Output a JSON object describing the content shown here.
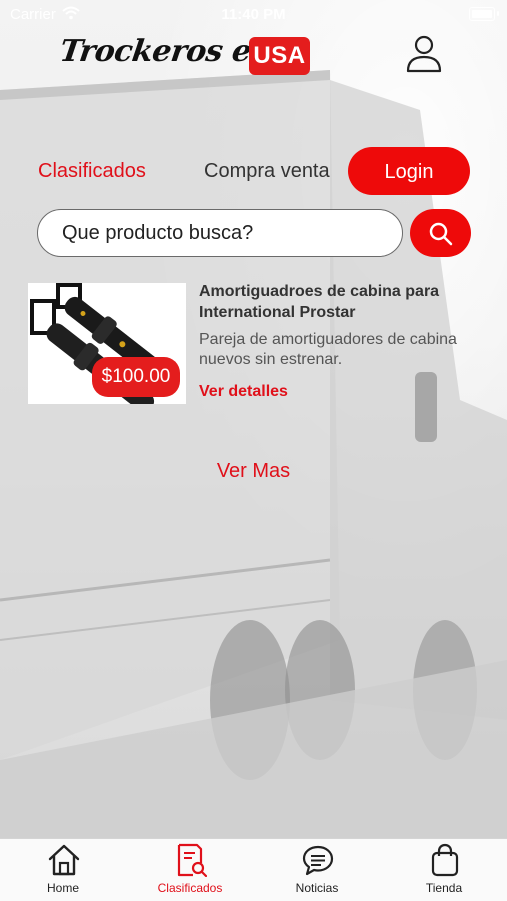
{
  "status_bar": {
    "carrier": "Carrier",
    "time": "11:40 PM"
  },
  "header": {
    "logo_script_text": "Trockeros en",
    "logo_badge_text": "USA",
    "user_icon": "user-icon"
  },
  "nav": {
    "clasificados": "Clasificados",
    "compra_venta": "Compra venta",
    "login": "Login"
  },
  "search": {
    "placeholder": "Que producto busca?",
    "icon": "search-icon"
  },
  "products": [
    {
      "title": "Amortiguadroes de cabina para International Prostar",
      "description": "Pareja de amortiguadores de cabina nuevos sin estrenar.",
      "price": "$100.00",
      "link_label": "Ver detalles"
    }
  ],
  "ver_mas": "Ver Mas",
  "tabbar": {
    "items": [
      {
        "label": "Home",
        "icon": "home-icon",
        "active": false
      },
      {
        "label": "Clasificados",
        "icon": "classifieds-search-icon",
        "active": true
      },
      {
        "label": "Noticias",
        "icon": "chat-bubble-icon",
        "active": false
      },
      {
        "label": "Tienda",
        "icon": "shopping-bag-icon",
        "active": false
      }
    ]
  },
  "colors": {
    "accent": "#EE0A0A",
    "accent_text": "#E0101A",
    "text": "#333333",
    "tabbar_bg": "#FAFAFA"
  }
}
